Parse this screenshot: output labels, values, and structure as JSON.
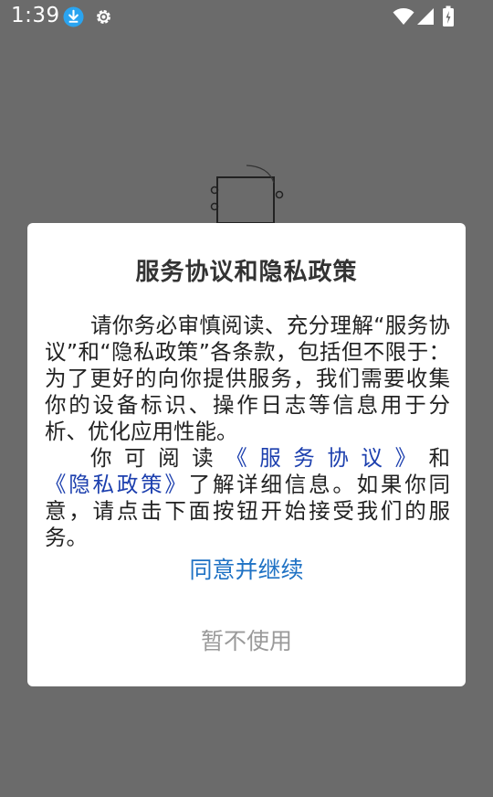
{
  "status_bar": {
    "time": "1:39"
  },
  "dialog": {
    "title": "服务协议和隐私政策",
    "para1": "请你务必审慎阅读、充分理解“服务协议”和“隐私政策”各条款，包括但不限于：为了更好的向你提供服务，我们需要收集你的设备标识、操作日志等信息用于分析、优化应用性能。",
    "para2_prefix": "你可阅读",
    "service_link": "《服务协议》",
    "para2_and": "和",
    "privacy_link": "《隐私政策》",
    "para2_suffix": "了解详细信息。如果你同意，请点击下面按钮开始接受我们的服务。",
    "agree_label": "同意并继续",
    "decline_label": "暂不使用"
  },
  "colors": {
    "overlay": "#6b6b6b",
    "link": "#1c3fae",
    "agree": "#1f72c4",
    "decline": "#9a9a9a"
  }
}
